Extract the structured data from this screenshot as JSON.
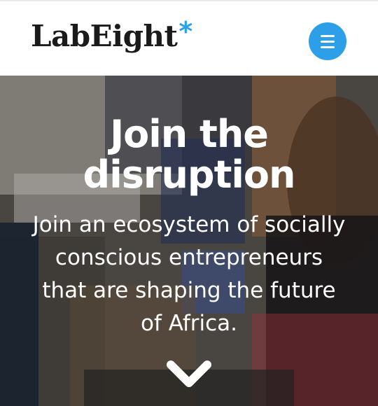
{
  "header": {
    "logo_text": "LabEight",
    "logo_mark": "*",
    "menu_icon": "hamburger-menu-icon",
    "accent_color": "#2d9fe8"
  },
  "hero": {
    "title_line1": "Join the",
    "title_line2": "disruption",
    "subtitle_line1": "Join an ecosystem of socially",
    "subtitle_line2": "conscious entrepreneurs",
    "subtitle_line3": "that are shaping the future",
    "subtitle_line4": "of Africa.",
    "scroll_icon": "chevron-down-icon"
  }
}
